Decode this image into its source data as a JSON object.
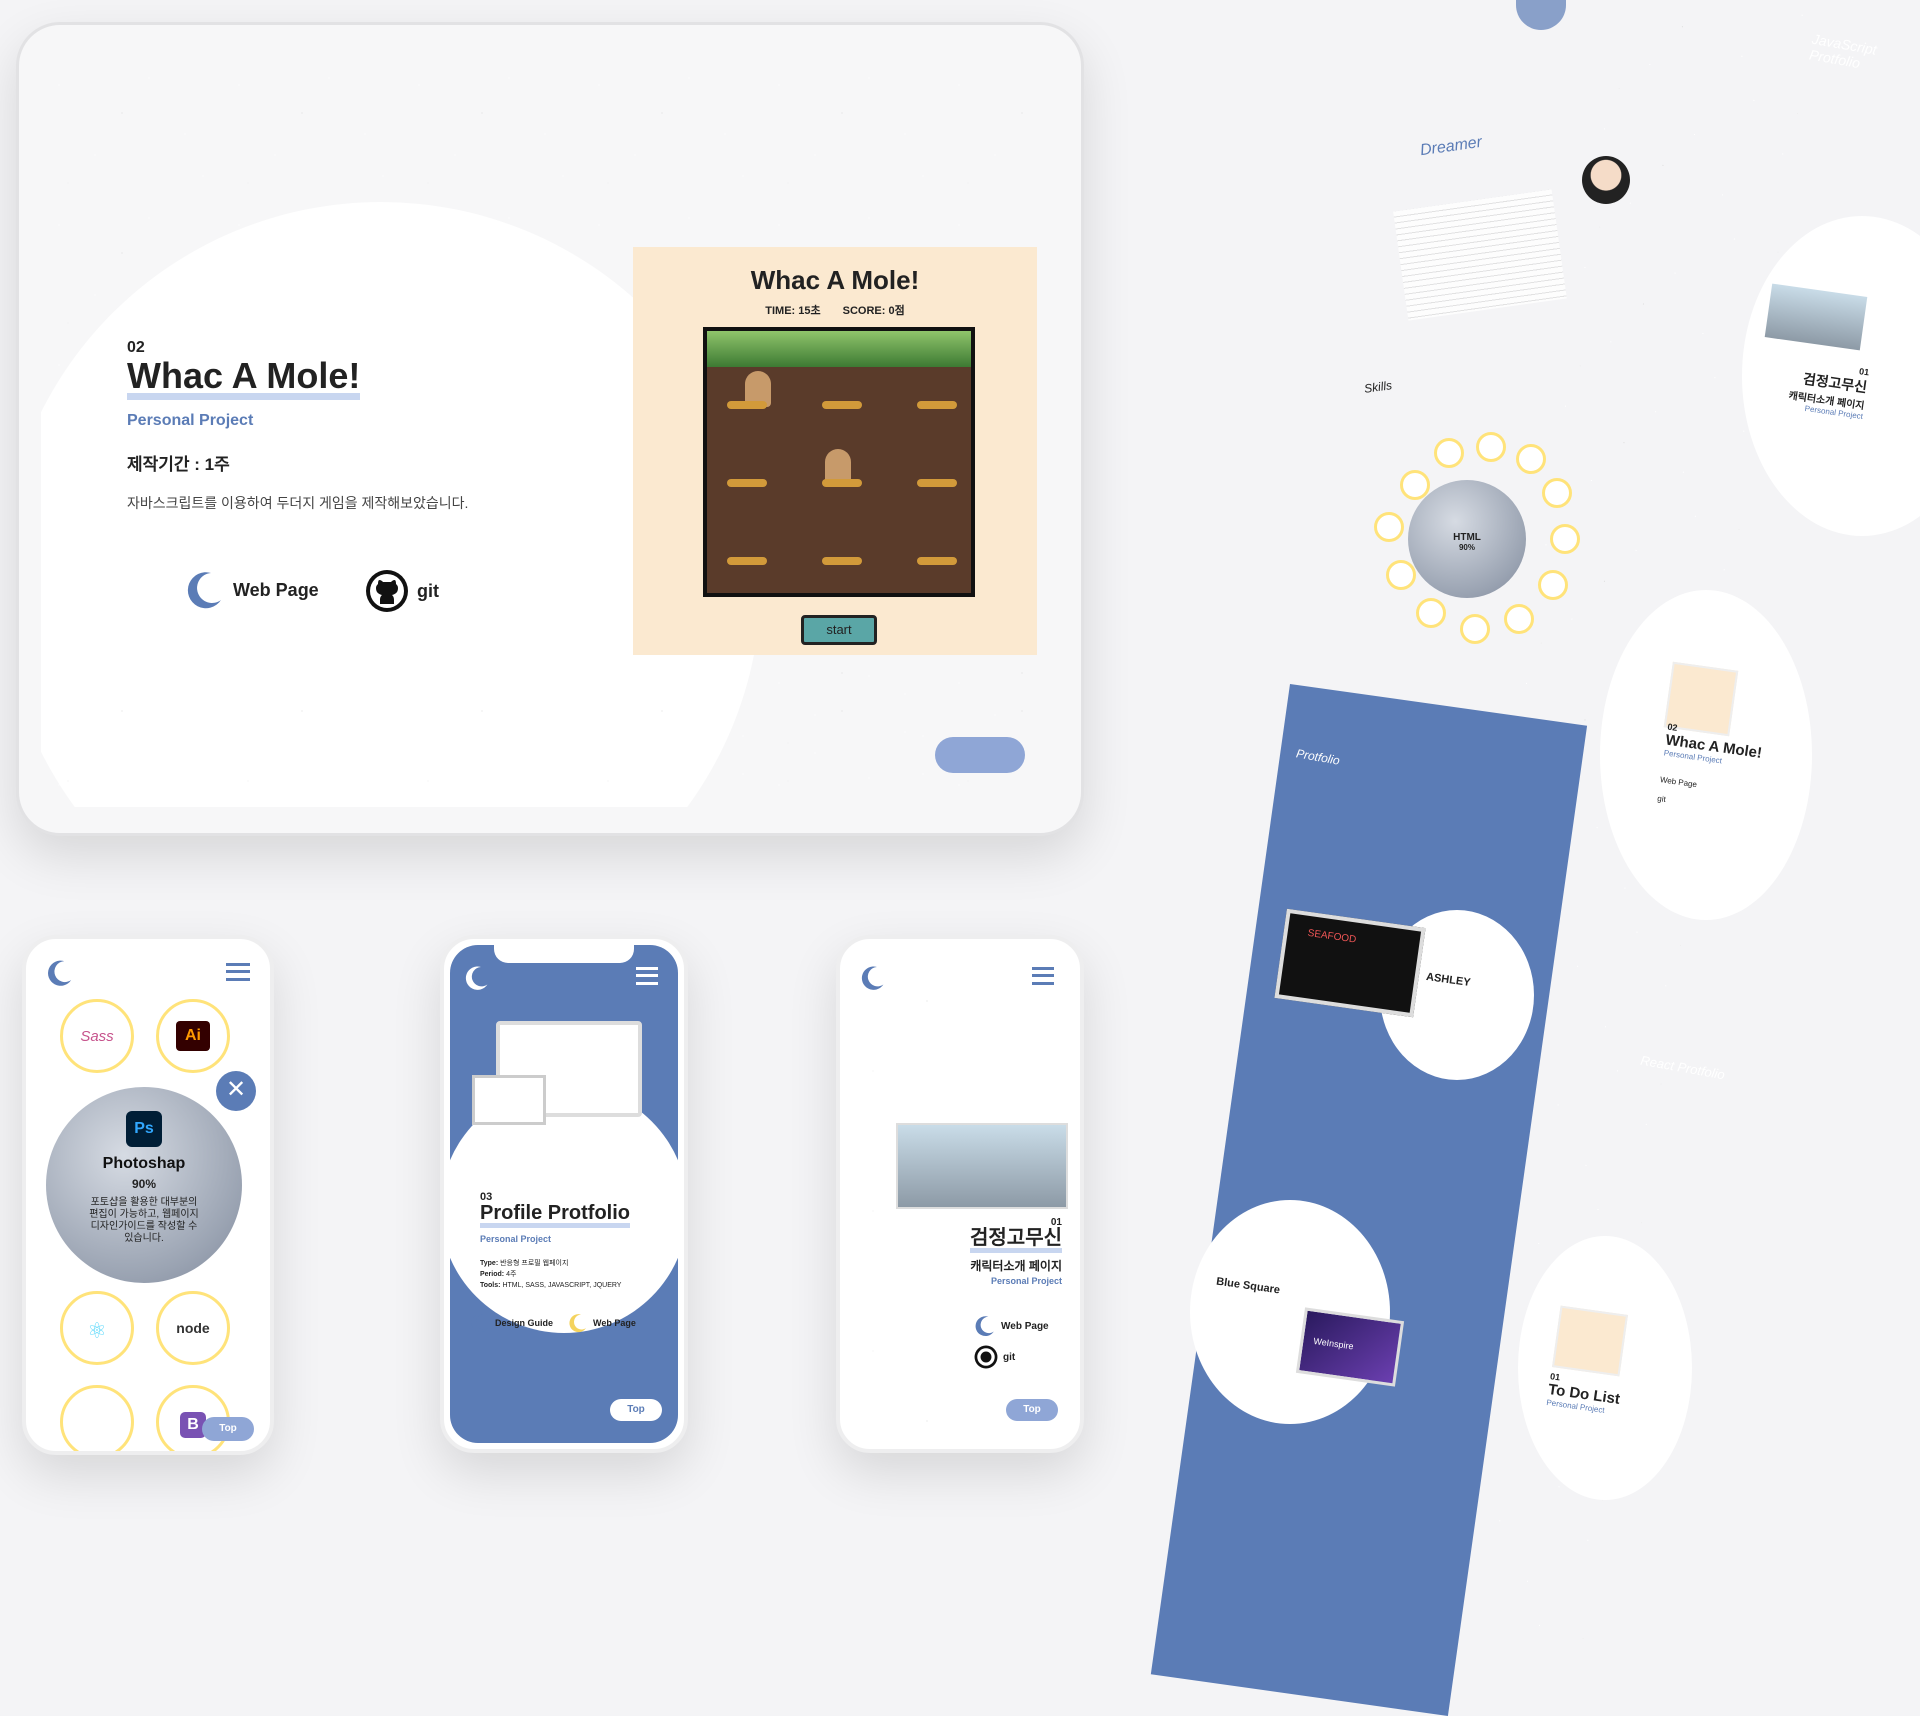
{
  "tablet": {
    "number": "02",
    "title": "Whac A Mole!",
    "subtitle": "Personal Project",
    "period": "제작기간 : 1주",
    "description": "자바스크립트를 이용하여 두더지 게임을 제작해보았습니다.",
    "webpage_label": "Web Page",
    "git_label": "git",
    "game": {
      "title": "Whac A Mole!",
      "time": "TIME: 15초",
      "score": "SCORE: 0점",
      "start": "start"
    }
  },
  "phone1": {
    "skill_name": "Photoshap",
    "skill_percent": "90%",
    "skill_desc": "포토샵을 활용한 대부분의 편집이 가능하고, 웹페이지 디자인가이드를 작성할 수 있습니다.",
    "ai_label": "Ai",
    "ps_label": "Ps",
    "sass_label": "Sass",
    "node_label": "node",
    "b_label": "B",
    "top_label": "Top"
  },
  "phone2": {
    "number": "03",
    "title": "Profile Protfolio",
    "subtitle": "Personal Project",
    "type_label": "Type:",
    "type_value": "반응형 프로필 웹페이지",
    "period_label": "Period:",
    "period_value": "4주",
    "tools_label": "Tools:",
    "tools_value": "HTML, SASS, JAVASCRIPT, JQUERY",
    "design_label": "Design Guide",
    "webpage_label": "Web Page",
    "top_label": "Top"
  },
  "phone3": {
    "number": "01",
    "title": "검정고무신",
    "subtitle": "캐릭터소개 페이지",
    "project": "Personal Project",
    "webpage_label": "Web Page",
    "git_label": "git",
    "top_label": "Top"
  },
  "longpage": {
    "dreamer": "Dreamer",
    "skills": "Skills",
    "html_label": "HTML",
    "html_percent": "90%",
    "js_portfolio": "JavaScript Protfolio",
    "card1_title": "검정고무신",
    "card1_sub": "캐릭터소개 페이지",
    "card1_project": "Personal Project",
    "card1_num": "01",
    "card2_num": "02",
    "card2_title": "Whac A Mole!",
    "card2_project": "Personal Project",
    "webpage_label": "Web Page",
    "git_label": "git",
    "portfolio": "Protfolio",
    "ashley": "ASHLEY",
    "seafood": "SEAFOOD",
    "react_portfolio": "React Protfolio",
    "blue_square": "Blue Square",
    "todo_num": "01",
    "todo_title": "To Do List",
    "todo_project": "Personal Project",
    "design_label": "Design Guide",
    "weinspire": "WeInspire"
  }
}
